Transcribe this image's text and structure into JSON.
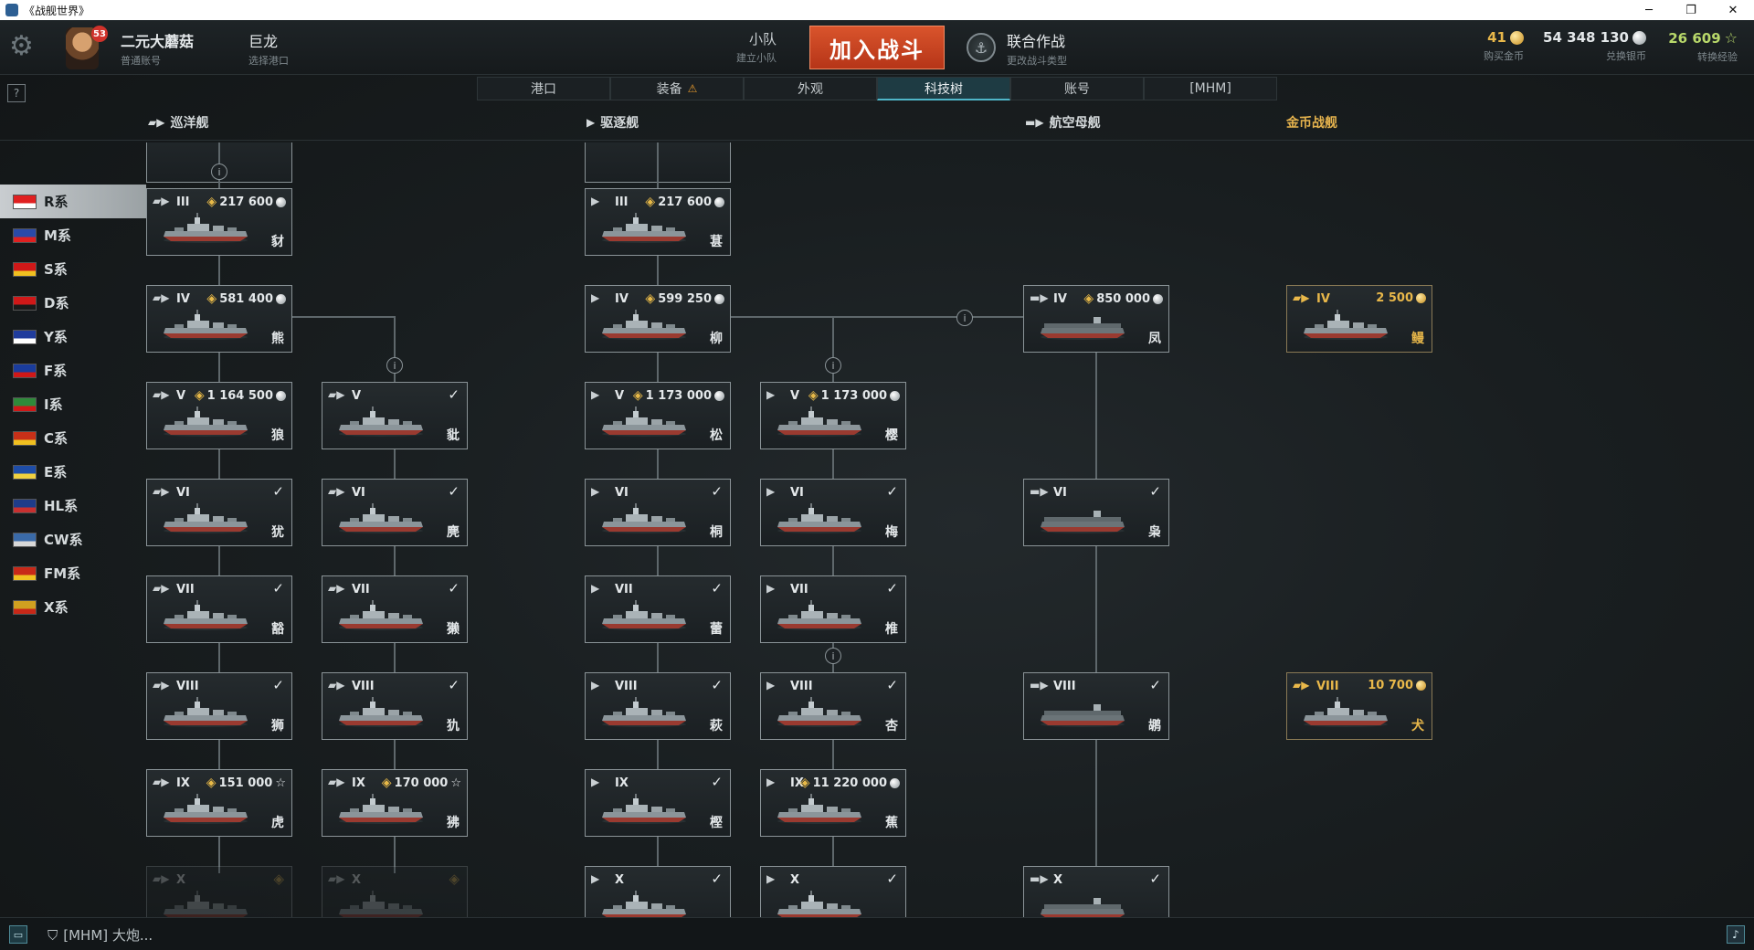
{
  "window": {
    "title": "《战舰世界》",
    "min": "─",
    "max": "❐",
    "close": "✕"
  },
  "account": {
    "name": "二元大蘑菇",
    "type": "普通账号",
    "level": "53"
  },
  "port": {
    "name": "巨龙",
    "hint": "选择港口"
  },
  "squad": {
    "name": "小队",
    "hint": "建立小队"
  },
  "battle_button": "加入战斗",
  "mode": {
    "name": "联合作战",
    "hint": "更改战斗类型"
  },
  "currencies": {
    "gold": {
      "value": "41",
      "label": "购买金币",
      "color": "#e9b84a"
    },
    "silver": {
      "value": "54 348 130",
      "label": "兑换银币",
      "color": "#e4e8ea"
    },
    "xp": {
      "value": "26 609",
      "label": "转换经验",
      "color": "#b8d86a"
    }
  },
  "tabs": [
    "港口",
    "装备",
    "外观",
    "科技树",
    "账号",
    "[MHM]"
  ],
  "active_tab": "科技树",
  "help": "?",
  "categories": [
    {
      "label": "巡洋舰",
      "icon": "cruiser-icon"
    },
    {
      "label": "驱逐舰",
      "icon": "destroyer-icon"
    },
    {
      "label": "航空母舰",
      "icon": "carrier-icon"
    },
    {
      "label": "金币战舰",
      "icon": "premium-icon",
      "gold": true
    }
  ],
  "nations": [
    "R系",
    "M系",
    "S系",
    "D系",
    "Y系",
    "F系",
    "I系",
    "C系",
    "E系",
    "HL系",
    "CW系",
    "FM系",
    "X系"
  ],
  "active_nation": "R系",
  "ships": [
    {
      "id": "c3",
      "type": "cruiser",
      "tier": "III",
      "cost": "217 600",
      "cur": "silver",
      "name": "豺"
    },
    {
      "id": "c4",
      "type": "cruiser",
      "tier": "IV",
      "cost": "581 400",
      "cur": "silver",
      "name": "熊"
    },
    {
      "id": "c5a",
      "type": "cruiser",
      "tier": "V",
      "cost": "1 164 500",
      "cur": "silver",
      "name": "狼"
    },
    {
      "id": "c5b",
      "type": "cruiser",
      "tier": "V",
      "done": true,
      "name": "豼"
    },
    {
      "id": "c6a",
      "type": "cruiser",
      "tier": "VI",
      "done": true,
      "name": "犹"
    },
    {
      "id": "c6b",
      "type": "cruiser",
      "tier": "VI",
      "done": true,
      "name": "麂"
    },
    {
      "id": "c7a",
      "type": "cruiser",
      "tier": "VII",
      "done": true,
      "name": "豁"
    },
    {
      "id": "c7b",
      "type": "cruiser",
      "tier": "VII",
      "done": true,
      "name": "獭"
    },
    {
      "id": "c8a",
      "type": "cruiser",
      "tier": "VIII",
      "done": true,
      "name": "狮"
    },
    {
      "id": "c8b",
      "type": "cruiser",
      "tier": "VIII",
      "done": true,
      "name": "犰"
    },
    {
      "id": "c9a",
      "type": "cruiser",
      "tier": "IX",
      "cost": "151 000",
      "cur": "xp",
      "name": "虎"
    },
    {
      "id": "c9b",
      "type": "cruiser",
      "tier": "IX",
      "cost": "170 000",
      "cur": "xp",
      "name": "狒"
    },
    {
      "id": "c10a",
      "type": "cruiser",
      "tier": "X",
      "dim": true,
      "name": ""
    },
    {
      "id": "c10b",
      "type": "cruiser",
      "tier": "X",
      "dim": true,
      "name": ""
    },
    {
      "id": "d3",
      "type": "destroyer",
      "tier": "III",
      "cost": "217 600",
      "cur": "silver",
      "name": "葚"
    },
    {
      "id": "d4",
      "type": "destroyer",
      "tier": "IV",
      "cost": "599 250",
      "cur": "silver",
      "name": "柳"
    },
    {
      "id": "d5a",
      "type": "destroyer",
      "tier": "V",
      "cost": "1 173 000",
      "cur": "silver",
      "name": "松"
    },
    {
      "id": "d5b",
      "type": "destroyer",
      "tier": "V",
      "cost": "1 173 000",
      "cur": "silver",
      "name": "樱"
    },
    {
      "id": "d6a",
      "type": "destroyer",
      "tier": "VI",
      "done": true,
      "name": "桐"
    },
    {
      "id": "d6b",
      "type": "destroyer",
      "tier": "VI",
      "done": true,
      "name": "梅"
    },
    {
      "id": "d7a",
      "type": "destroyer",
      "tier": "VII",
      "done": true,
      "name": "蕾"
    },
    {
      "id": "d7b",
      "type": "destroyer",
      "tier": "VII",
      "done": true,
      "name": "椎"
    },
    {
      "id": "d8a",
      "type": "destroyer",
      "tier": "VIII",
      "done": true,
      "name": "萩"
    },
    {
      "id": "d8b",
      "type": "destroyer",
      "tier": "VIII",
      "done": true,
      "name": "杏"
    },
    {
      "id": "d9a",
      "type": "destroyer",
      "tier": "IX",
      "done": true,
      "name": "樫"
    },
    {
      "id": "d9b",
      "type": "destroyer",
      "tier": "IX",
      "cost": "11 220 000",
      "cur": "silver",
      "name": "蕉"
    },
    {
      "id": "d10a",
      "type": "destroyer",
      "tier": "X",
      "done": true,
      "name": ""
    },
    {
      "id": "d10b",
      "type": "destroyer",
      "tier": "X",
      "done": true,
      "name": ""
    },
    {
      "id": "a4",
      "type": "carrier",
      "tier": "IV",
      "cost": "850 000",
      "cur": "silver",
      "name": "凤"
    },
    {
      "id": "a6",
      "type": "carrier",
      "tier": "VI",
      "done": true,
      "name": "枭"
    },
    {
      "id": "a8",
      "type": "carrier",
      "tier": "VIII",
      "done": true,
      "name": "鹕"
    },
    {
      "id": "a10",
      "type": "carrier",
      "tier": "X",
      "done": true,
      "name": ""
    },
    {
      "id": "p4",
      "type": "premium",
      "tier": "IV",
      "cost": "2 500",
      "cur": "gold",
      "name": "鳗"
    },
    {
      "id": "p8",
      "type": "premium",
      "tier": "VIII",
      "cost": "10 700",
      "cur": "gold",
      "name": "犬"
    }
  ],
  "chat": {
    "text": "[MHM] 大炮..."
  },
  "icons": {
    "settings": "gear-icon",
    "info": "info-icon",
    "check": "check-icon",
    "silver": "silver-coin-icon",
    "gold": "gold-coin-icon",
    "xp": "star-icon",
    "tag": "price-tag-icon"
  }
}
